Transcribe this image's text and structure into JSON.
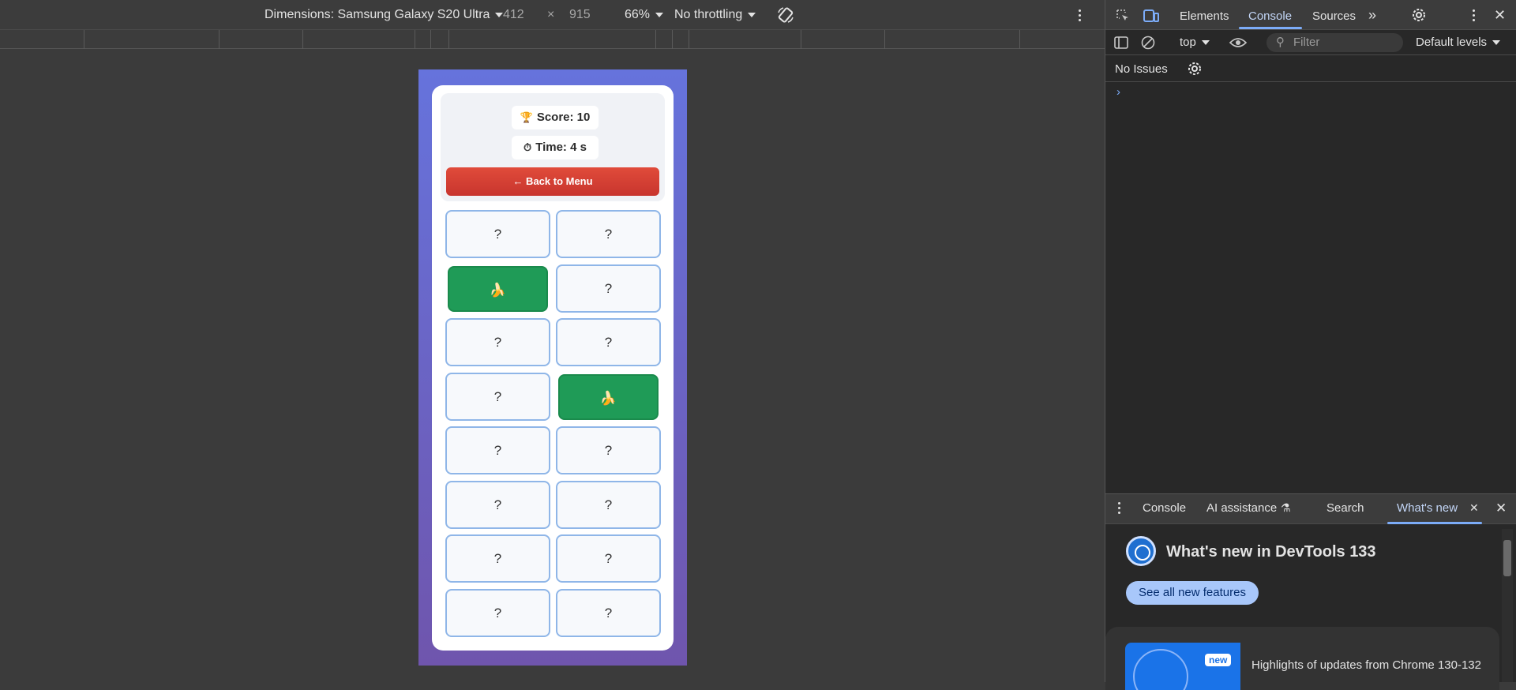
{
  "device_toolbar": {
    "dimensions_label": "Dimensions: Samsung Galaxy S20 Ultra",
    "width": "412",
    "times": "×",
    "height": "915",
    "zoom": "66%",
    "throttling": "No throttling"
  },
  "game": {
    "score_label": "Score:",
    "score_value": "10",
    "time_label": "Time:",
    "time_value": "4",
    "time_unit": "s",
    "back_button": "← Back to Menu",
    "hidden_symbol": "?",
    "matched_symbol": "🍌",
    "tiles": [
      {
        "row": 0,
        "col": 0,
        "state": "hidden"
      },
      {
        "row": 0,
        "col": 1,
        "state": "hidden"
      },
      {
        "row": 1,
        "col": 0,
        "state": "matched"
      },
      {
        "row": 1,
        "col": 1,
        "state": "hidden"
      },
      {
        "row": 2,
        "col": 0,
        "state": "hidden"
      },
      {
        "row": 2,
        "col": 1,
        "state": "hidden"
      },
      {
        "row": 3,
        "col": 0,
        "state": "hidden"
      },
      {
        "row": 3,
        "col": 1,
        "state": "matched"
      },
      {
        "row": 4,
        "col": 0,
        "state": "hidden"
      },
      {
        "row": 4,
        "col": 1,
        "state": "hidden"
      },
      {
        "row": 5,
        "col": 0,
        "state": "hidden"
      },
      {
        "row": 5,
        "col": 1,
        "state": "hidden"
      },
      {
        "row": 6,
        "col": 0,
        "state": "hidden"
      },
      {
        "row": 6,
        "col": 1,
        "state": "hidden"
      },
      {
        "row": 7,
        "col": 0,
        "state": "hidden"
      },
      {
        "row": 7,
        "col": 1,
        "state": "hidden"
      }
    ]
  },
  "devtools": {
    "tabs": [
      "Elements",
      "Console",
      "Sources"
    ],
    "active_tab": "Console",
    "context": "top",
    "filter_placeholder": "Filter",
    "levels": "Default levels",
    "issues": "No Issues",
    "prompt": "›",
    "drawer_tabs": [
      "Console",
      "AI assistance",
      "Search",
      "What's new"
    ],
    "whats_new_title": "What's new in DevTools 133",
    "see_all_button": "See all new features",
    "badge_new": "new",
    "highlight_text": "Highlights of updates from Chrome 130-132"
  }
}
